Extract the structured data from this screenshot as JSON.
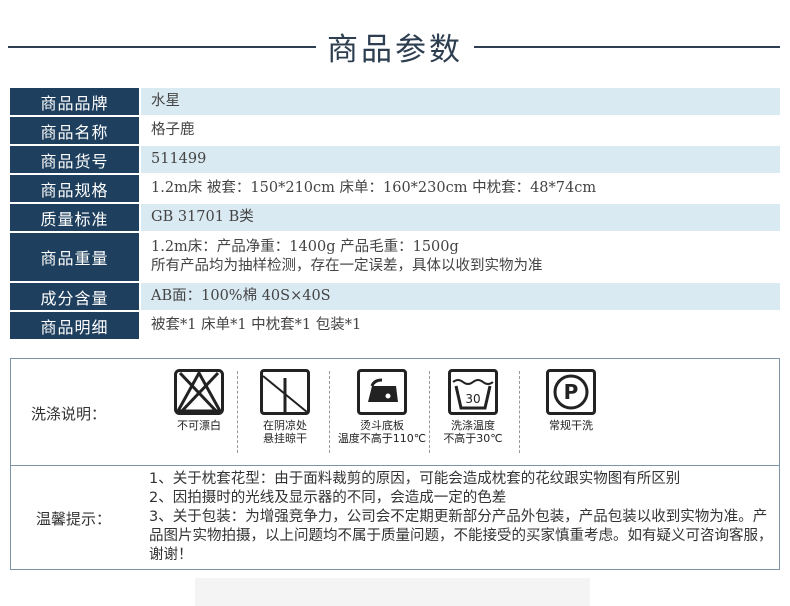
{
  "header": {
    "title": "商品参数"
  },
  "params": [
    {
      "label": "商品品牌",
      "lines": [
        "水星"
      ]
    },
    {
      "label": "商品名称",
      "lines": [
        "格子鹿"
      ]
    },
    {
      "label": "商品货号",
      "lines": [
        "511499"
      ]
    },
    {
      "label": "商品规格",
      "lines": [
        "1.2m床 被套：150*210cm 床单：160*230cm 中枕套：48*74cm"
      ]
    },
    {
      "label": "质量标准",
      "lines": [
        "GB 31701 B类"
      ]
    },
    {
      "label": "商品重量",
      "lines": [
        "1.2m床：产品净重：1400g 产品毛重：1500g",
        "所有产品均为抽样检测，存在一定误差，具体以收到实物为准"
      ]
    },
    {
      "label": "成分含量",
      "lines": [
        "AB面：100%棉 40S×40S"
      ]
    },
    {
      "label": "商品明细",
      "lines": [
        "被套*1 床单*1 中枕套*1 包装*1"
      ]
    }
  ],
  "care": {
    "label": "洗涤说明：",
    "icons": [
      {
        "icon": "no-bleach-icon",
        "caption": [
          "不可漂白"
        ]
      },
      {
        "icon": "shade-hang-dry-icon",
        "caption": [
          "在阴凉处",
          "悬挂晾干"
        ]
      },
      {
        "icon": "iron-icon",
        "caption": [
          "烫斗底板",
          "温度不高于110℃"
        ]
      },
      {
        "icon": "wash-30-icon",
        "caption": [
          "洗涤温度",
          "不高于30℃"
        ],
        "temp": "30"
      },
      {
        "icon": "dry-clean-p-icon",
        "caption": [
          "常规干洗"
        ],
        "letter": "P"
      }
    ]
  },
  "tips": {
    "label": "温馨提示：",
    "lines": [
      "1、关于枕套花型：由于面料裁剪的原因，可能会造成枕套的花纹跟实物图有所区别",
      "2、因拍摄时的光线及显示器的不同，会造成一定的色差",
      "3、关于包装：为增强竞争力，公司会不定期更新部分产品外包装，产品包装以收到实物为准。产品图片实物拍摄，以上问题均不属于质量问题，不能接受的买家慎重考虑。如有疑义可咨询客服，谢谢！"
    ]
  }
}
